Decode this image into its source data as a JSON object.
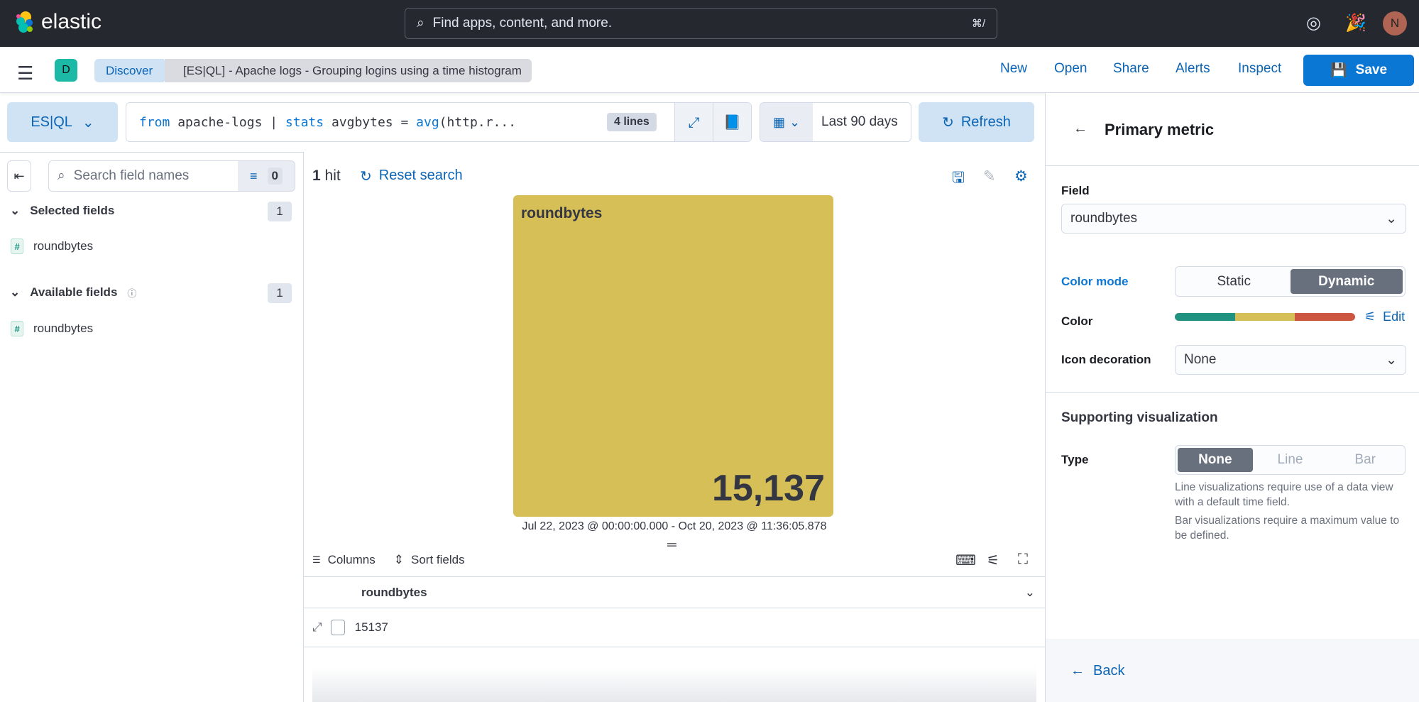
{
  "header": {
    "brand": "elastic",
    "search_placeholder": "Find apps, content, and more.",
    "shortcut": "⌘/",
    "avatar": "N"
  },
  "nav": {
    "space": "D",
    "breadcrumbs": [
      "Discover",
      "[ES|QL] - Apache logs - Grouping logins using a time histogram"
    ],
    "links": [
      "New",
      "Open",
      "Share",
      "Alerts",
      "Inspect"
    ],
    "save": "Save"
  },
  "query": {
    "lang": "ES|QL",
    "tokens": [
      "from",
      " apache-logs | ",
      "stats",
      " avgbytes = ",
      "avg",
      "(http.r..."
    ],
    "lines": "4 lines",
    "time": "Last 90 days",
    "refresh": "Refresh"
  },
  "sidebar": {
    "search_placeholder": "Search field names",
    "filter_count": "0",
    "selected_label": "Selected fields",
    "selected_count": "1",
    "selected_fields": [
      "roundbytes"
    ],
    "available_label": "Available fields",
    "available_count": "1",
    "available_fields": [
      "roundbytes"
    ]
  },
  "main": {
    "hits_num": "1",
    "hits_label": "hit",
    "reset": "Reset search",
    "metric_title": "roundbytes",
    "metric_value": "15,137",
    "range": "Jul 22, 2023 @ 00:00:00.000 - Oct 20, 2023 @ 11:36:05.878",
    "columns": "Columns",
    "sort": "Sort fields",
    "column_header": "roundbytes",
    "rows": [
      "15137"
    ]
  },
  "panel": {
    "title": "Primary metric",
    "field_label": "Field",
    "field_value": "roundbytes",
    "color_mode_label": "Color mode",
    "color_modes": [
      "Static",
      "Dynamic"
    ],
    "color_label": "Color",
    "edit": "Edit",
    "palette": [
      "#209280",
      "#d6bf57",
      "#cc5642"
    ],
    "icon_label": "Icon decoration",
    "icon_value": "None",
    "supporting_title": "Supporting visualization",
    "type_label": "Type",
    "types": [
      "None",
      "Line",
      "Bar"
    ],
    "help1": "Line visualizations require use of a data view with a default time field.",
    "help2": "Bar visualizations require a maximum value to be defined.",
    "back": "Back"
  }
}
